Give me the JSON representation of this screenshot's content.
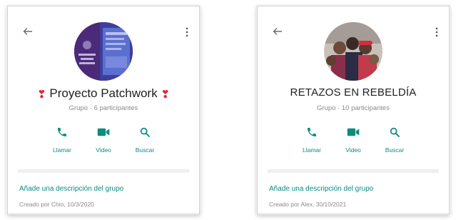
{
  "colors": {
    "accent": "#0a8d7e",
    "heart": "#e3263c",
    "muted": "#8a8a8a"
  },
  "icons": [
    "back-arrow-icon",
    "more-vert-icon",
    "phone-icon",
    "video-camera-icon",
    "search-icon",
    "heart-icon"
  ],
  "cards": [
    {
      "title_prefix": "❣",
      "title": "Proyecto Patchwork",
      "title_suffix": "❣",
      "subtitle": "Grupo · 6 participantes",
      "actions": {
        "call": "Llamar",
        "video": "Video",
        "search": "Buscar"
      },
      "description_link": "Añade una descripción del grupo",
      "created": "Creado por Chio, 10/3/2020"
    },
    {
      "title": "RETAZOS EN REBELDÍA",
      "subtitle": "Grupo · 10 participantes",
      "actions": {
        "call": "Llamar",
        "video": "Video",
        "search": "Buscar"
      },
      "description_link": "Añade una descripción del grupo",
      "created": "Creado por Alex, 30/10/2021"
    }
  ]
}
